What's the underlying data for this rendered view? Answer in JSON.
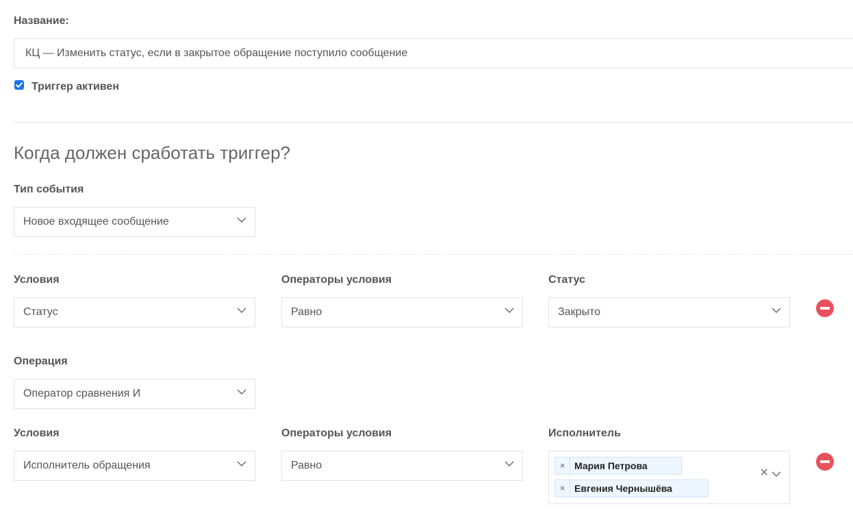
{
  "name": {
    "label": "Название:",
    "value": "КЦ — Изменить статус, если в закрытое обращение поступило сообщение"
  },
  "active": {
    "label": "Триггер активен",
    "checked": true
  },
  "section": {
    "title": "Когда должен сработать триггер?"
  },
  "event_type": {
    "label": "Тип события",
    "value": "Новое входящее сообщение"
  },
  "condition1": {
    "conditions_label": "Условия",
    "conditions_value": "Статус",
    "operators_label": "Операторы условия",
    "operators_value": "Равно",
    "target_label": "Статус",
    "target_value": "Закрыто"
  },
  "operation": {
    "label": "Операция",
    "value": "Оператор сравнения И"
  },
  "condition2": {
    "conditions_label": "Условия",
    "conditions_value": "Исполнитель обращения",
    "operators_label": "Операторы условия",
    "operators_value": "Равно",
    "target_label": "Исполнитель",
    "tags": [
      {
        "remove": "×",
        "text": "Мария Петрова"
      },
      {
        "remove": "×",
        "text": "Евгения Чернышёва"
      }
    ],
    "clear": "✕"
  },
  "colors": {
    "accent": "#1a73e8",
    "remove": "#e8505b"
  }
}
